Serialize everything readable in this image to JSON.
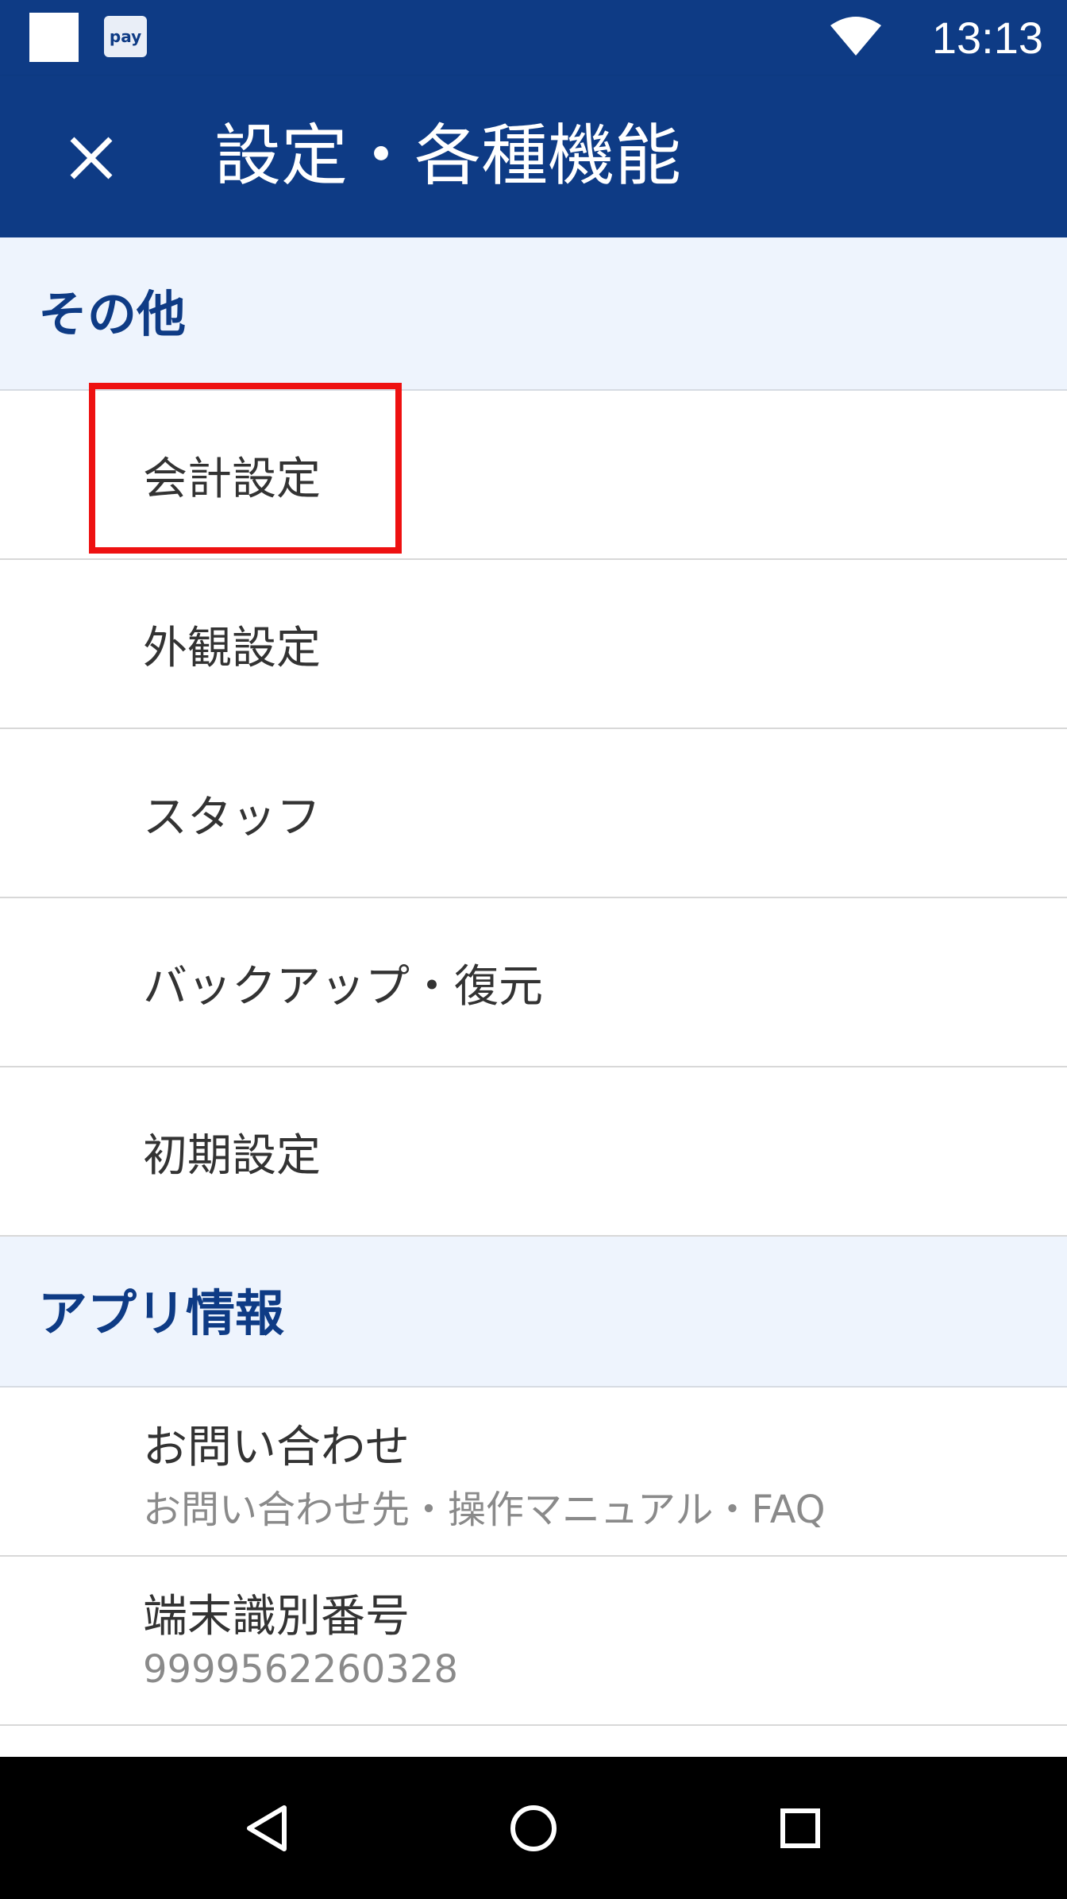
{
  "status_bar": {
    "pay_badge": "pay",
    "time": "13:13",
    "icons": [
      "notification-square-icon",
      "pay-app-icon",
      "wifi-icon"
    ]
  },
  "app_bar": {
    "title": "設定・各種機能",
    "close_icon": "close-icon",
    "background_color": "#0e3b85"
  },
  "sections": {
    "other": {
      "header": "その他",
      "items": [
        {
          "label": "会計設定"
        },
        {
          "label": "外観設定"
        },
        {
          "label": "スタッフ"
        },
        {
          "label": "バックアップ・復元"
        },
        {
          "label": "初期設定"
        }
      ]
    },
    "app_info": {
      "header": "アプリ情報",
      "items": [
        {
          "label": "お問い合わせ",
          "sub": "お問い合わせ先・操作マニュアル・FAQ"
        },
        {
          "label": "端末識別番号",
          "sub": "9999562260328"
        }
      ]
    }
  },
  "highlight": {
    "target": "会計設定",
    "color": "#ee1111"
  },
  "nav_bar": {
    "icons": [
      "back-icon",
      "home-icon",
      "recents-icon"
    ]
  }
}
